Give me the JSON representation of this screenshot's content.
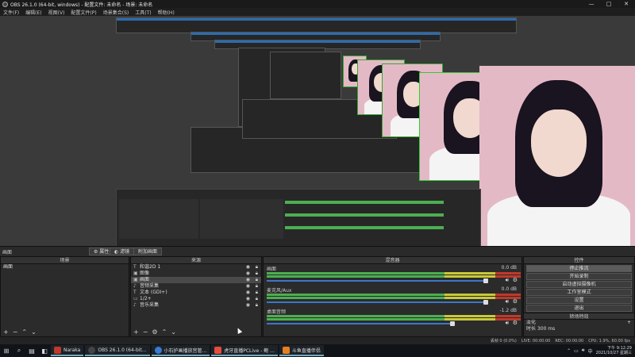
{
  "window": {
    "title": "OBS 26.1.0 (64-bit, windows) - 配置文件: 未命名 - 场景: 未命名"
  },
  "menu": [
    "文件(F)",
    "编辑(E)",
    "视图(V)",
    "配置文件(P)",
    "场景集合(S)",
    "工具(T)",
    "帮助(H)"
  ],
  "toolbar": {
    "scene_label": "画面",
    "props_label": "属性",
    "filters_label": "滤镜",
    "studio_label": "附加画面"
  },
  "docks": {
    "scenes": {
      "title": "场景",
      "items": [
        "画面"
      ]
    },
    "sources": {
      "title": "来源",
      "items": [
        {
          "icon": "T",
          "name": "和谐2D 1"
        },
        {
          "icon": "▣",
          "name": "图像"
        },
        {
          "icon": "▣",
          "name": "画面"
        },
        {
          "icon": "♪",
          "name": "音频采集"
        },
        {
          "icon": "T",
          "name": "文本 (GDI+)"
        },
        {
          "icon": "▭",
          "name": "1/2+"
        },
        {
          "icon": "♪",
          "name": "音乐采集"
        }
      ]
    },
    "mixer": {
      "title": "混音器",
      "channels": [
        {
          "name": "画面",
          "db": "0.0 dB",
          "level": 0.92
        },
        {
          "name": "麦克风/Aux",
          "db": "0.0 dB",
          "level": 0.92
        },
        {
          "name": "桌面音频",
          "db": "-1.2 dB",
          "level": 0.78
        }
      ]
    },
    "controls": {
      "title": "控件",
      "buttons": [
        "停止推流",
        "开始录制",
        "启动虚拟摄像机",
        "工作室模式",
        "设置",
        "退出"
      ]
    },
    "transitions": {
      "title": "转场特效",
      "type": "淡化",
      "duration_label": "时长",
      "duration": "300 ms"
    }
  },
  "status": {
    "dropped": "丢帧 0 (0.0%)",
    "live": "LIVE: 00:00:00",
    "rec": "REC: 00:00:00",
    "cpu": "CPU: 1.9%, 60.00 fps"
  },
  "taskbar": {
    "apps": [
      {
        "label": "Naraka",
        "color": "#c0392b"
      },
      {
        "label": "OBS 26.1.0 (64-bit...",
        "color": "#444"
      },
      {
        "label": "小石护画播放宫管...",
        "color": "#3a7bd5"
      },
      {
        "label": "虎牙直播PCLive - 鲍 ...",
        "color": "#e74c3c"
      },
      {
        "label": "斗鱼直播伴侣",
        "color": "#e67e22"
      }
    ],
    "lang": "中",
    "time": "下午 9:12:29",
    "date": "2021/10/27 星期三"
  },
  "colors": {
    "accent": "#3b77c8",
    "meter_green": "#4caf50",
    "meter_yellow": "#c9c93a",
    "meter_red": "#c0392b"
  }
}
